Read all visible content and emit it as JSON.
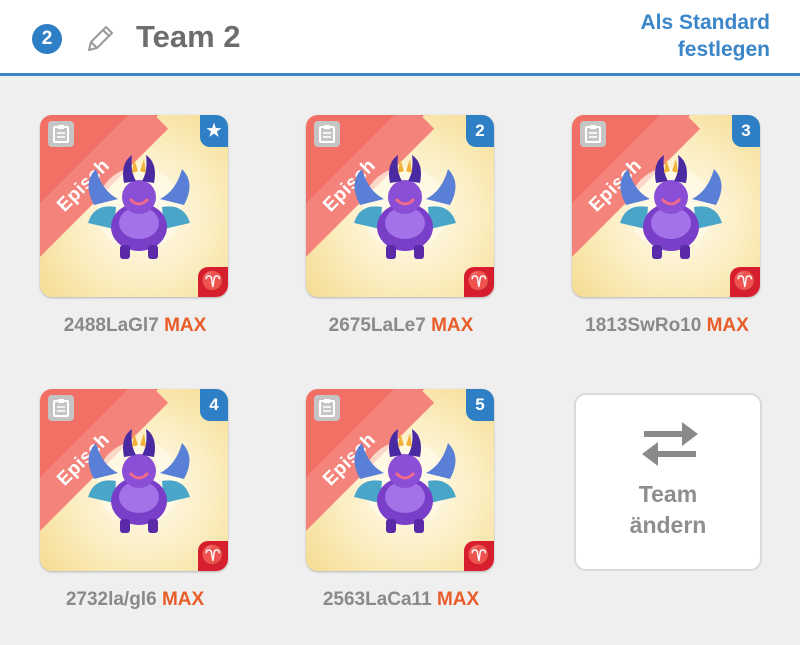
{
  "header": {
    "team_number": "2",
    "title": "Team 2",
    "set_default_line1": "Als Standard",
    "set_default_line2": "festlegen"
  },
  "colors": {
    "accent": "#3a86c8",
    "rarity": "#f26f66",
    "max": "#e85d2a",
    "element": "#d61e2f"
  },
  "monsters": [
    {
      "rarity": "Episch",
      "rank": "★",
      "rank_icon": "star-icon",
      "element": "♈",
      "element_icon": "aries-icon",
      "name": "2488LaGl7",
      "level": "MAX"
    },
    {
      "rarity": "Episch",
      "rank": "2",
      "element": "♈",
      "element_icon": "aries-icon",
      "name": "2675LaLe7",
      "level": "MAX"
    },
    {
      "rarity": "Episch",
      "rank": "3",
      "element": "♈",
      "element_icon": "aries-icon",
      "name": "1813SwRo10",
      "level": "MAX"
    },
    {
      "rarity": "Episch",
      "rank": "4",
      "element": "♈",
      "element_icon": "aries-icon",
      "name": "2732la/gl6",
      "level": "MAX"
    },
    {
      "rarity": "Episch",
      "rank": "5",
      "element": "♈",
      "element_icon": "aries-icon",
      "name": "2563LaCa11",
      "level": "MAX"
    }
  ],
  "change_team": {
    "line1": "Team",
    "line2": "ändern"
  }
}
